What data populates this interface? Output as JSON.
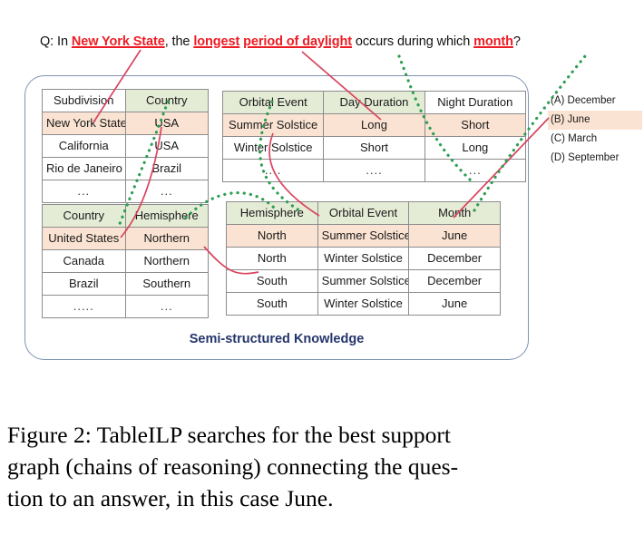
{
  "question": {
    "prefix": "Q: In ",
    "hl1": "New York State",
    "mid1": ", the ",
    "hl2": "longest",
    "mid2": "  ",
    "hl3": "period of daylight",
    "mid3": " occurs during which ",
    "hl4": "month",
    "suffix": "?"
  },
  "knowledge_box": {
    "label": "Semi-structured Knowledge"
  },
  "tables": {
    "subdivision": {
      "headers": [
        "Subdivision",
        "Country"
      ],
      "header_green": [
        false,
        true
      ],
      "rows": [
        [
          "New York State",
          "USA"
        ],
        [
          "California",
          "USA"
        ],
        [
          "Rio de Janeiro",
          "Brazil"
        ],
        [
          "...",
          "..."
        ]
      ],
      "highlight_row": 0
    },
    "orbital": {
      "headers": [
        "Orbital Event",
        "Day Duration",
        "Night Duration"
      ],
      "header_green": [
        true,
        true,
        false
      ],
      "rows": [
        [
          "Summer Solstice",
          "Long",
          "Short"
        ],
        [
          "Winter Solstice",
          "Short",
          "Long"
        ],
        [
          "....",
          "....",
          "..."
        ]
      ],
      "highlight_row": 0
    },
    "country": {
      "headers": [
        "Country",
        "Hemisphere"
      ],
      "header_green": [
        true,
        true
      ],
      "rows": [
        [
          "United States",
          "Northern"
        ],
        [
          "Canada",
          "Northern"
        ],
        [
          "Brazil",
          "Southern"
        ],
        [
          ".....",
          "..."
        ]
      ],
      "highlight_row": 0
    },
    "hemisphere": {
      "headers": [
        "Hemisphere",
        "Orbital Event",
        "Month"
      ],
      "header_green": [
        true,
        true,
        true
      ],
      "rows": [
        [
          "North",
          "Summer Solstice",
          "June"
        ],
        [
          "North",
          "Winter Solstice",
          "December"
        ],
        [
          "South",
          "Summer Solstice",
          "December"
        ],
        [
          "South",
          "Winter Solstice",
          "June"
        ]
      ],
      "highlight_row": 0
    }
  },
  "answers": {
    "options": [
      {
        "label": "(A) December",
        "selected": false
      },
      {
        "label": "(B) June",
        "selected": true
      },
      {
        "label": "(C) March",
        "selected": false
      },
      {
        "label": "(D) September",
        "selected": false
      }
    ]
  },
  "caption": {
    "line1": "Figure 2:  TableILP searches for the best support",
    "line2": "graph (chains of reasoning) connecting the ques-",
    "line3": "tion to an answer, in this case June."
  },
  "colors": {
    "highlight_red": "#ed1c24",
    "connector_red": "#d9445f",
    "connector_green": "#2e9e52",
    "header_green_bg": "#e5ecd6",
    "row_peach_bg": "#fae3d2",
    "box_border_blue": "#7f93b5",
    "label_navy": "#24356b"
  }
}
